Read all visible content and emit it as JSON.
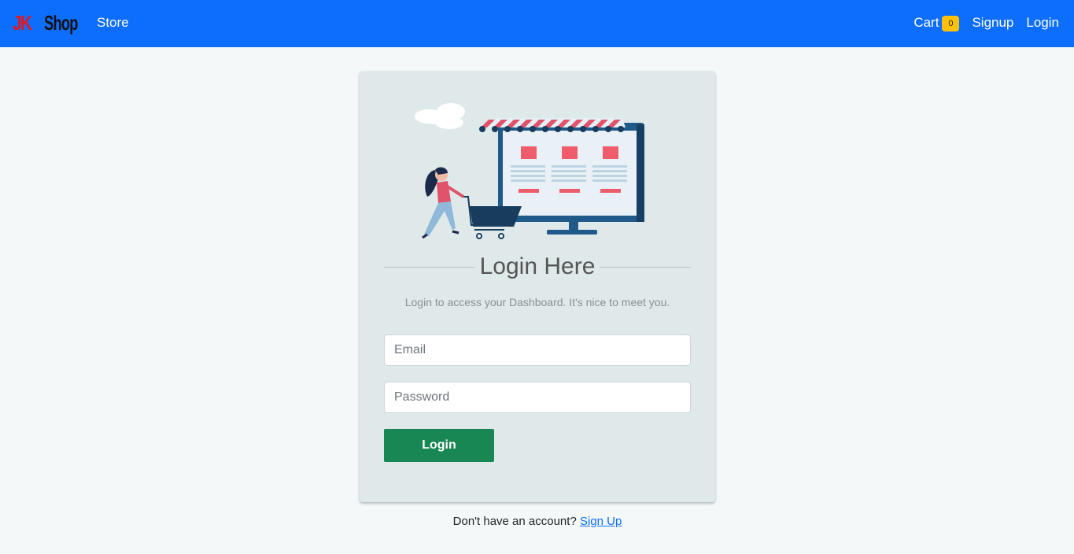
{
  "navbar": {
    "brand_part1": "JK",
    "brand_part2": "Shop",
    "store_label": "Store",
    "cart_label": "Cart",
    "cart_count": "0",
    "signup_label": "Signup",
    "login_label": "Login"
  },
  "login_card": {
    "illustration": "shopping-illustration",
    "title": "Login Here",
    "subtitle": "Login to access your Dashboard. It's nice to meet you.",
    "email_placeholder": "Email",
    "password_placeholder": "Password",
    "login_button": "Login"
  },
  "footer": {
    "prompt": "Don't have an account?",
    "signup_link": "Sign Up"
  },
  "colors": {
    "navbar": "#0d6efd",
    "brand_jk": "#e3161d",
    "badge": "#ffc107",
    "login_button": "#198754",
    "card": "#dfe9ea",
    "page_bg": "#f4f8f9"
  }
}
